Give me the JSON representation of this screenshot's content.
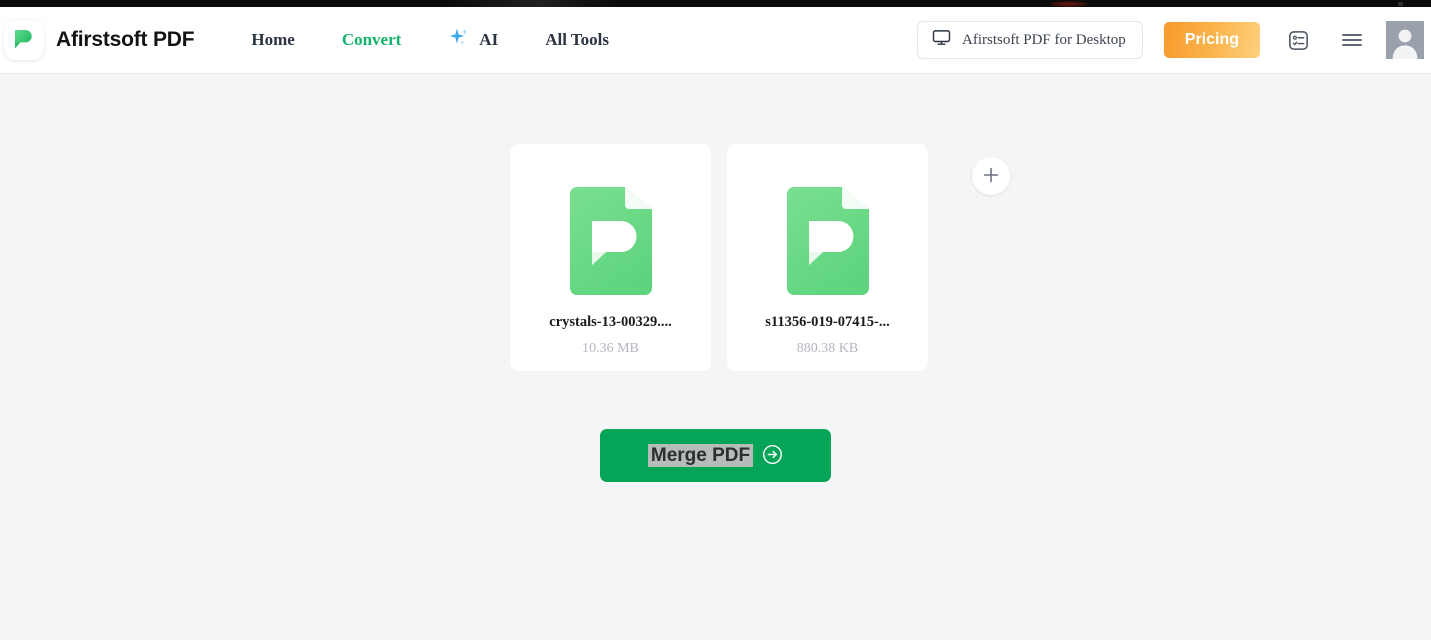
{
  "browser": {
    "strip": "dark-browser-chrome-strip"
  },
  "header": {
    "logo_icon": "afirstsoft-pdf-logo-icon",
    "brand_name": "Afirstsoft PDF",
    "nav": [
      {
        "label": "Home",
        "active": false
      },
      {
        "label": "Convert",
        "active": true
      },
      {
        "label": "AI",
        "active": false,
        "icon": "ai-sparkle-icon"
      },
      {
        "label": "All Tools",
        "active": false
      }
    ],
    "desktop_button": {
      "label": "Afirstsoft PDF for Desktop",
      "icon": "monitor-icon"
    },
    "pricing_button": {
      "label": "Pricing"
    },
    "tasks_icon": "task-list-icon",
    "menu_icon": "hamburger-menu-icon",
    "avatar_icon": "user-avatar-icon"
  },
  "main": {
    "files": [
      {
        "name": "crystals-13-00329....",
        "size": "10.36 MB",
        "icon": "pdf-file-icon"
      },
      {
        "name": "s11356-019-07415-...",
        "size": "880.38 KB",
        "icon": "pdf-file-icon"
      }
    ],
    "add_file_button": {
      "icon": "plus-icon"
    },
    "merge_button": {
      "label": "Merge PDF",
      "icon": "arrow-right-circle-icon"
    }
  },
  "colors": {
    "brand_green": "#13b36b",
    "merge_green": "#05a457",
    "pricing_orange": "#f79a2b",
    "page_background": "#f4f5f7",
    "file_icon_green": "#6ddc8b"
  }
}
